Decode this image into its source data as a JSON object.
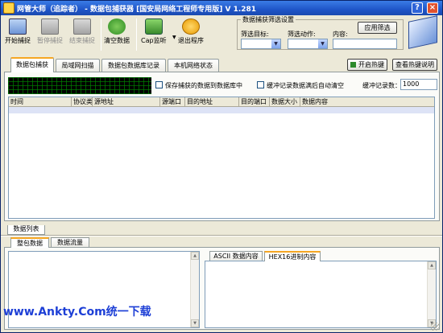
{
  "window": {
    "title": "网管大师（追踪者） - 数据包捕获器 [国安局网络工程师专用版] V 1.281",
    "help_glyph": "?",
    "close_glyph": "×"
  },
  "toolbar": {
    "start_capture": "开始捕捉",
    "pause_capture": "暂停捕捉",
    "stop_capture": "结束捕捉",
    "clear_data": "清空数据",
    "cap_listen": "Cap监听",
    "exit_program": "退出程序",
    "dropdown_caret": "▼"
  },
  "filter": {
    "group_title": "数据捕获筛选设置",
    "target_label": "筛选目标:",
    "action_label": "筛选动作:",
    "content_label": "内容:",
    "target_value": "",
    "action_value": "",
    "content_value": "",
    "apply_button": "应用筛选",
    "arrow": "▼"
  },
  "tabs": [
    {
      "label": "数据包捕获",
      "active": true
    },
    {
      "label": "局域网扫描",
      "active": false
    },
    {
      "label": "数据包数据库记录",
      "active": false
    },
    {
      "label": "本机网络状态",
      "active": false
    }
  ],
  "hotkey": {
    "enable_label": "开启热键",
    "help_label": "查看热键说明"
  },
  "capture_options": {
    "save_to_db": "保存捕获的数据到数据库中",
    "auto_clear": "缓冲记录数据满后自动清空",
    "buffer_label": "缓冲记录数：",
    "buffer_value": "1000"
  },
  "grid": {
    "columns": [
      "时间",
      "协议类型",
      "源地址",
      "源端口",
      "目的地址",
      "目的端口",
      "数据大小",
      "数据内容"
    ]
  },
  "list_tab": "数据列表",
  "lower_tabs": [
    {
      "label": "整包数据",
      "active": true
    },
    {
      "label": "数据流量",
      "active": false
    }
  ],
  "content_tabs": [
    {
      "label": "ASCII 数据内容",
      "active": false
    },
    {
      "label": "HEX16进制内容",
      "active": true
    }
  ],
  "scroll": {
    "up": "▲",
    "down": "▼"
  },
  "watermark": "www.Ankty.Com统一下载",
  "colors": {
    "title_bar": "#1f55c8",
    "active_tab_accent": "#f5a623",
    "watermark": "#1d3fd6"
  }
}
